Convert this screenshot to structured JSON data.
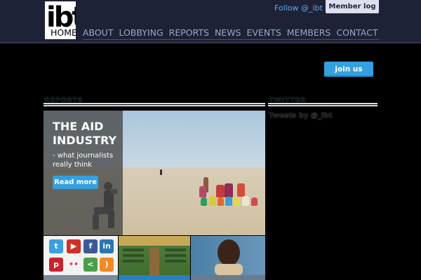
{
  "header": {
    "logo_text": "ibt",
    "follow": "Follow @_ibt",
    "member_login": "Member log in",
    "nav": [
      "HOME",
      "ABOUT",
      "LOBBYING",
      "REPORTS",
      "NEWS",
      "EVENTS",
      "MEMBERS",
      "CONTACT"
    ]
  },
  "join_us": "join us",
  "reports": {
    "heading": "REPORTS",
    "hero": {
      "title": "THE AID INDUSTRY",
      "subtitle": "- what journalists really think",
      "button": "Read more"
    }
  },
  "twitter": {
    "heading": "TWITTER",
    "tweets_label": "Tweets by @_ibt"
  },
  "social_icons": [
    "twitter-icon",
    "youtube-icon",
    "facebook-icon",
    "linkedin-icon",
    "pinterest-icon",
    "flickr-icon",
    "share-icon",
    "rss-icon"
  ],
  "colors": {
    "header_bg": "#1e2237",
    "accent_blue": "#35a0e0",
    "nav_text": "#9ea5c4"
  }
}
